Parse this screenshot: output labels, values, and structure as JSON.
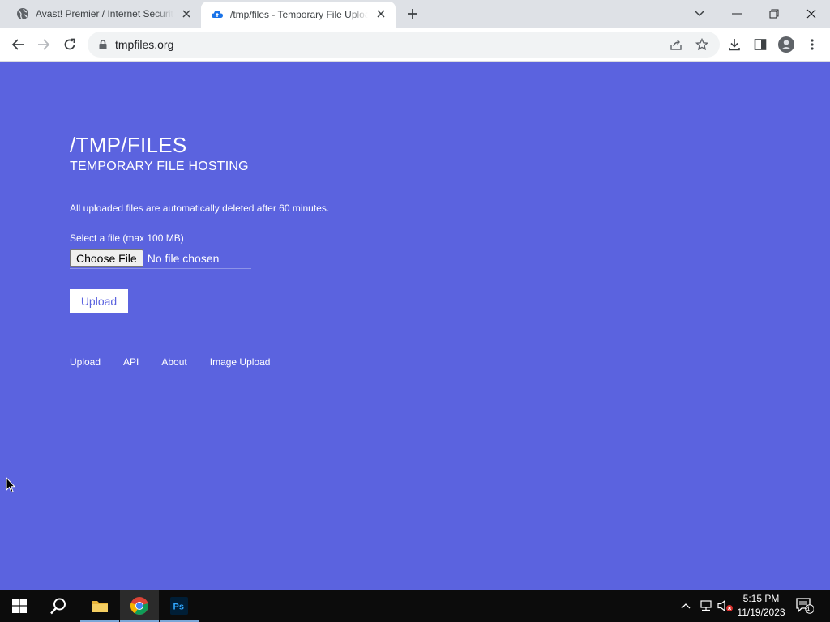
{
  "browser": {
    "tabs": [
      {
        "title": "Avast! Premier / Internet Security",
        "icon": "globe-icon",
        "active": false
      },
      {
        "title": "/tmp/files - Temporary File Upload",
        "icon": "cloud-upload-icon",
        "active": true
      }
    ],
    "address": "tmpfiles.org"
  },
  "page": {
    "title": "/TMP/FILES",
    "subtitle": "TEMPORARY FILE HOSTING",
    "notice": "All uploaded files are automatically deleted after 60 minutes.",
    "file_label": "Select a file (max 100 MB)",
    "choose_file_label": "Choose File",
    "no_file_text": "No file chosen",
    "upload_label": "Upload",
    "footer_links": [
      "Upload",
      "API",
      "About",
      "Image Upload"
    ]
  },
  "taskbar": {
    "time": "5:15 PM",
    "date": "11/19/2023",
    "notification_count": "4"
  },
  "colors": {
    "page_background": "#5b63df",
    "tab_strip": "#dee1e6",
    "taskbar": "#0c0c0c"
  }
}
